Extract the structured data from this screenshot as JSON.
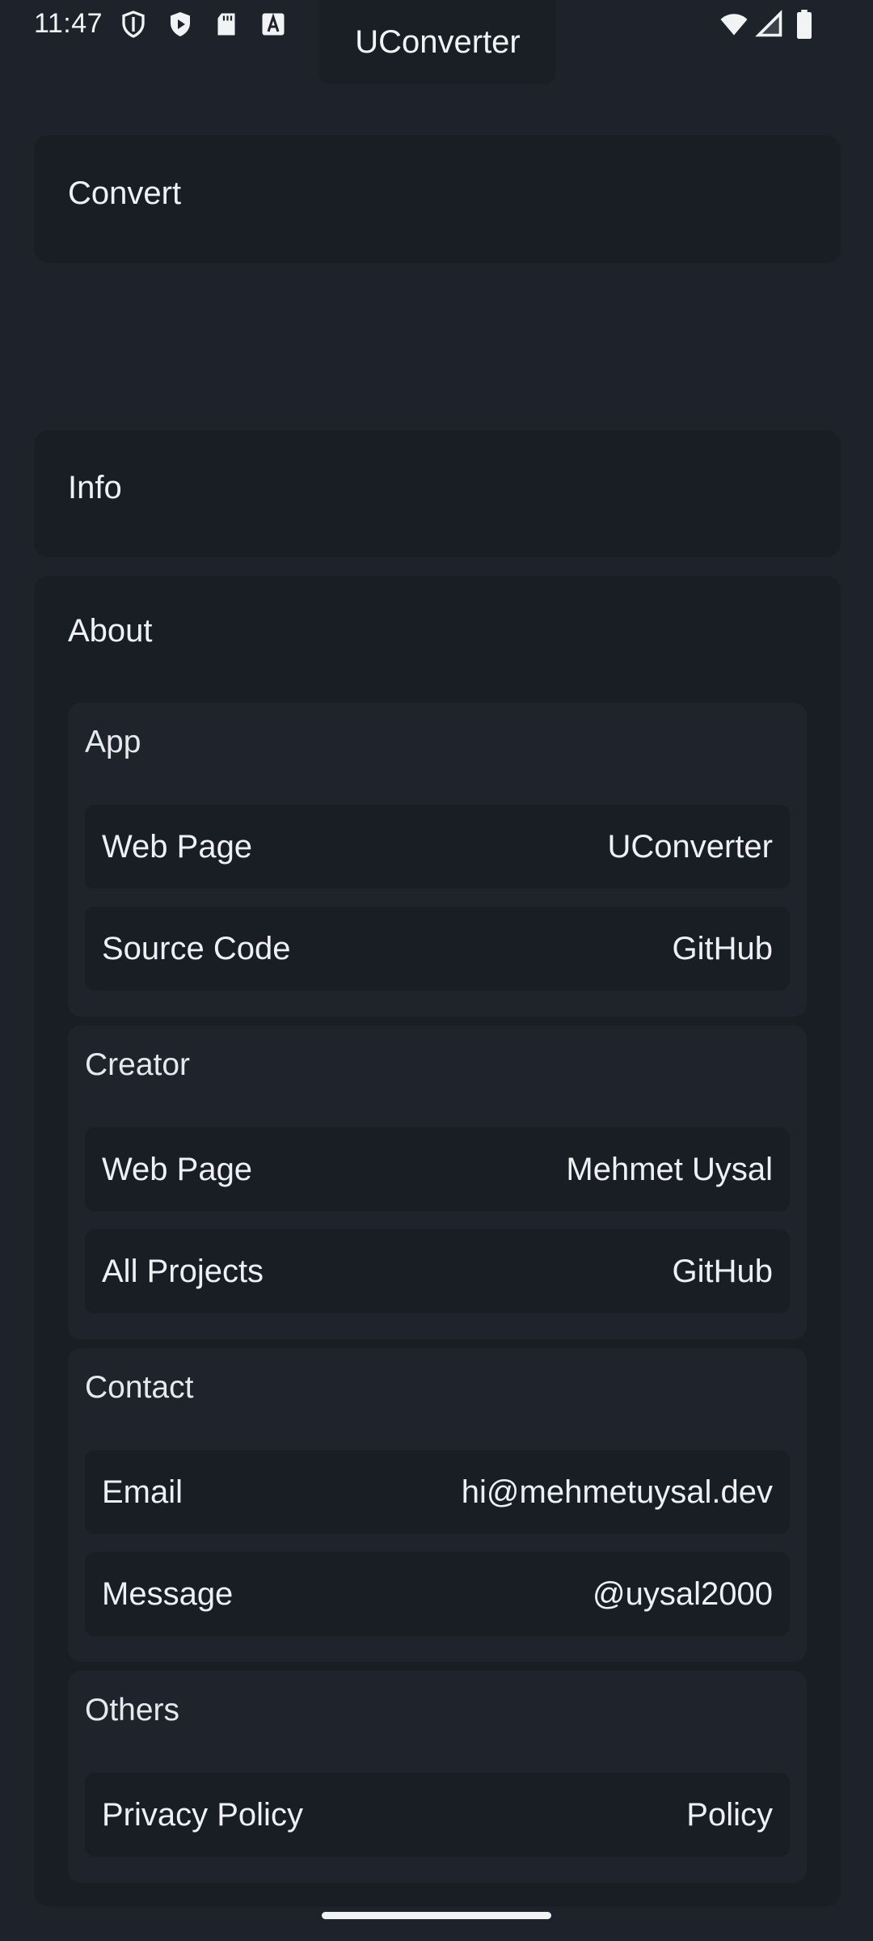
{
  "status_bar": {
    "time": "11:47",
    "left_icons": [
      "shield-outline-icon",
      "play-shield-icon",
      "sd-card-icon",
      "font-a-icon"
    ],
    "right_icons": [
      "wifi-icon",
      "signal-icon",
      "battery-icon"
    ]
  },
  "app": {
    "title": "UConverter"
  },
  "convert": {
    "label": "Convert"
  },
  "info": {
    "label": "Info"
  },
  "about": {
    "label": "About",
    "groups": [
      {
        "title": "App",
        "rows": [
          {
            "label": "Web Page",
            "value": "UConverter"
          },
          {
            "label": "Source Code",
            "value": "GitHub"
          }
        ]
      },
      {
        "title": "Creator",
        "rows": [
          {
            "label": "Web Page",
            "value": "Mehmet Uysal"
          },
          {
            "label": "All Projects",
            "value": "GitHub"
          }
        ]
      },
      {
        "title": "Contact",
        "rows": [
          {
            "label": "Email",
            "value": "hi@mehmetuysal.dev"
          },
          {
            "label": "Message",
            "value": "@uysal2000"
          }
        ]
      },
      {
        "title": "Others",
        "rows": [
          {
            "label": "Privacy Policy",
            "value": "Policy"
          }
        ]
      }
    ]
  },
  "colors": {
    "background": "#1e232b",
    "card": "#191d24",
    "group": "#1f242c",
    "text": "#eef0f3"
  }
}
